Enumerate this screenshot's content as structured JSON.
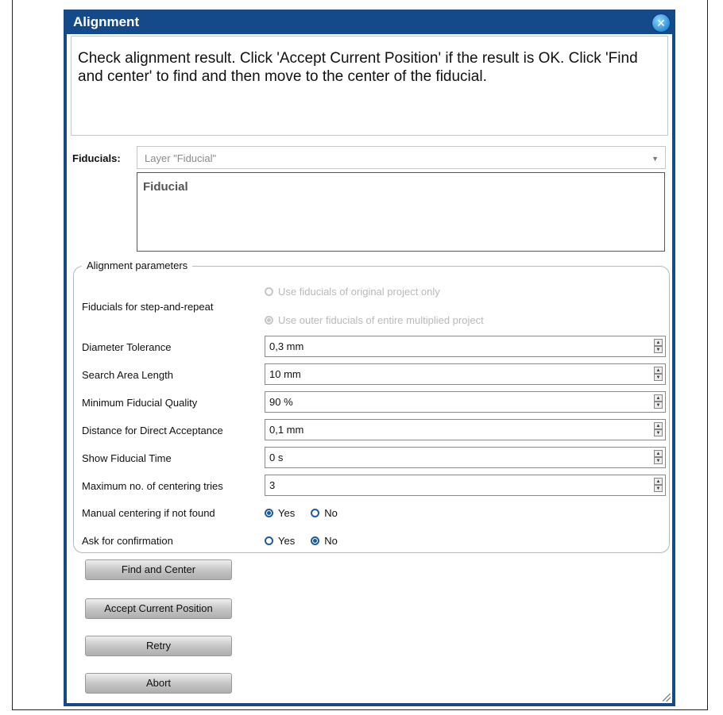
{
  "window": {
    "title": "Alignment"
  },
  "message": "Check alignment result. Click 'Accept Current Position' if the result is OK. Click 'Find and center' to find and then move to the center of the fiducial.",
  "fiducials": {
    "label": "Fiducials:",
    "selected": "Layer \"Fiducial\"",
    "items": [
      "Fiducial"
    ]
  },
  "params": {
    "legend": "Alignment parameters",
    "step_repeat": {
      "label": "Fiducials for step-and-repeat",
      "options": [
        {
          "label": "Use fiducials of original project only",
          "checked": false,
          "enabled": false
        },
        {
          "label": "Use outer fiducials of entire multiplied project",
          "checked": true,
          "enabled": false
        }
      ]
    },
    "fields": [
      {
        "label": "Diameter Tolerance",
        "value": "0,3 mm"
      },
      {
        "label": "Search Area Length",
        "value": "10 mm"
      },
      {
        "label": "Minimum Fiducial Quality",
        "value": "90 %"
      },
      {
        "label": "Distance for Direct Acceptance",
        "value": "0,1 mm"
      },
      {
        "label": "Show Fiducial Time",
        "value": "0 s"
      },
      {
        "label": "Maximum no. of centering tries",
        "value": "3"
      }
    ],
    "manual_centering": {
      "label": "Manual centering if not found",
      "yes": "Yes",
      "no": "No",
      "selected": "Yes"
    },
    "confirmation": {
      "label": "Ask for confirmation",
      "yes": "Yes",
      "no": "No",
      "selected": "No"
    }
  },
  "buttons": {
    "find_center": "Find and Center",
    "accept": "Accept Current Position",
    "retry": "Retry",
    "abort": "Abort"
  },
  "colors": {
    "titlebar": "#14498a",
    "radio": "#1f5a9e"
  }
}
